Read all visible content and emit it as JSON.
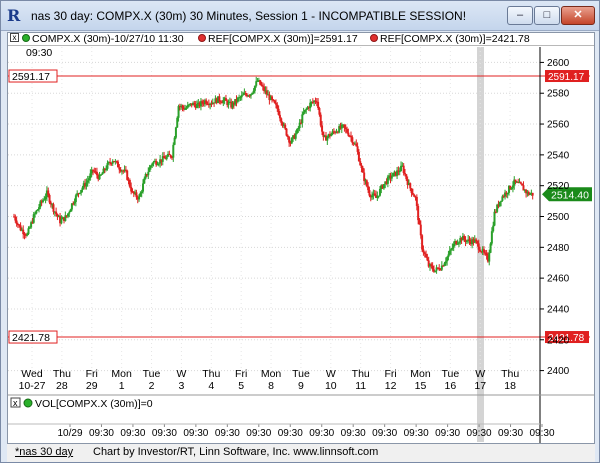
{
  "window": {
    "title": "nas 30 day: COMPX.X (30m) 30 Minutes, Session 1 - INCOMPATIBLE SESSION!",
    "app_icon": "R",
    "controls": [
      "minimize",
      "maximize",
      "close"
    ]
  },
  "legend": {
    "toggle": "x",
    "symbol": "COMPX.X (30m)-10/27/10 11:30",
    "ref1": "REF[COMPX.X (30m)]=2591.17",
    "ref2": "REF[COMPX.X (30m)]=2421.78",
    "time": "09:30"
  },
  "volume_legend": {
    "toggle": "x",
    "label": "VOL[COMPX.X (30m)]=0"
  },
  "footer": {
    "tab": "*nas 30 day",
    "credit": "Chart by Investor/RT, Linn Software, Inc. www.linnsoft.com"
  },
  "colors": {
    "up_candle": "#2aa02a",
    "down_candle": "#e02020",
    "ref_line": "#e02020",
    "last_price_badge": "#1a8a1a"
  },
  "chart_data": {
    "type": "candlestick",
    "ylim": [
      2390,
      2610
    ],
    "y_ticks": [
      2400,
      2420,
      2440,
      2460,
      2480,
      2500,
      2520,
      2540,
      2560,
      2580,
      2600
    ],
    "ref_lines": [
      {
        "label": "2591.17",
        "value": 2591.17
      },
      {
        "label": "2421.78",
        "value": 2421.78
      }
    ],
    "last_price": {
      "label": "2514.40",
      "value": 2514.4
    },
    "day_labels": [
      {
        "day": "Wed",
        "date": "10-27"
      },
      {
        "day": "Thu",
        "date": "28"
      },
      {
        "day": "Fri",
        "date": "29"
      },
      {
        "day": "Mon",
        "date": "1"
      },
      {
        "day": "Tue",
        "date": "2"
      },
      {
        "day": "W",
        "date": "3"
      },
      {
        "day": "Thu",
        "date": "4"
      },
      {
        "day": "Fri",
        "date": "5"
      },
      {
        "day": "Mon",
        "date": "8"
      },
      {
        "day": "Tue",
        "date": "9"
      },
      {
        "day": "W",
        "date": "10"
      },
      {
        "day": "Thu",
        "date": "11"
      },
      {
        "day": "Fri",
        "date": "12"
      },
      {
        "day": "Mon",
        "date": "15"
      },
      {
        "day": "Tue",
        "date": "16"
      },
      {
        "day": "W",
        "date": "17"
      },
      {
        "day": "Thu",
        "date": "18"
      }
    ],
    "time_labels": [
      "10/29",
      "09:30",
      "09:30",
      "09:30",
      "09:30",
      "09:30",
      "09:30",
      "09:30",
      "09:30",
      "09:30",
      "09:30",
      "09:30",
      "09:30",
      "09:30",
      "09:30",
      "09:30"
    ],
    "price_path": [
      2500,
      2492,
      2488,
      2500,
      2508,
      2515,
      2505,
      2497,
      2500,
      2510,
      2517,
      2522,
      2530,
      2525,
      2532,
      2537,
      2532,
      2528,
      2515,
      2512,
      2526,
      2535,
      2536,
      2538,
      2540,
      2572,
      2570,
      2573,
      2572,
      2575,
      2574,
      2576,
      2575,
      2572,
      2576,
      2579,
      2580,
      2588,
      2582,
      2576,
      2570,
      2558,
      2548,
      2555,
      2567,
      2573,
      2576,
      2550,
      2553,
      2556,
      2558,
      2553,
      2545,
      2527,
      2515,
      2512,
      2520,
      2525,
      2528,
      2532,
      2520,
      2512,
      2480,
      2468,
      2465,
      2468,
      2475,
      2483,
      2486,
      2484,
      2484,
      2478,
      2472,
      2502,
      2512,
      2517,
      2522,
      2520,
      2515,
      2514.4
    ]
  }
}
